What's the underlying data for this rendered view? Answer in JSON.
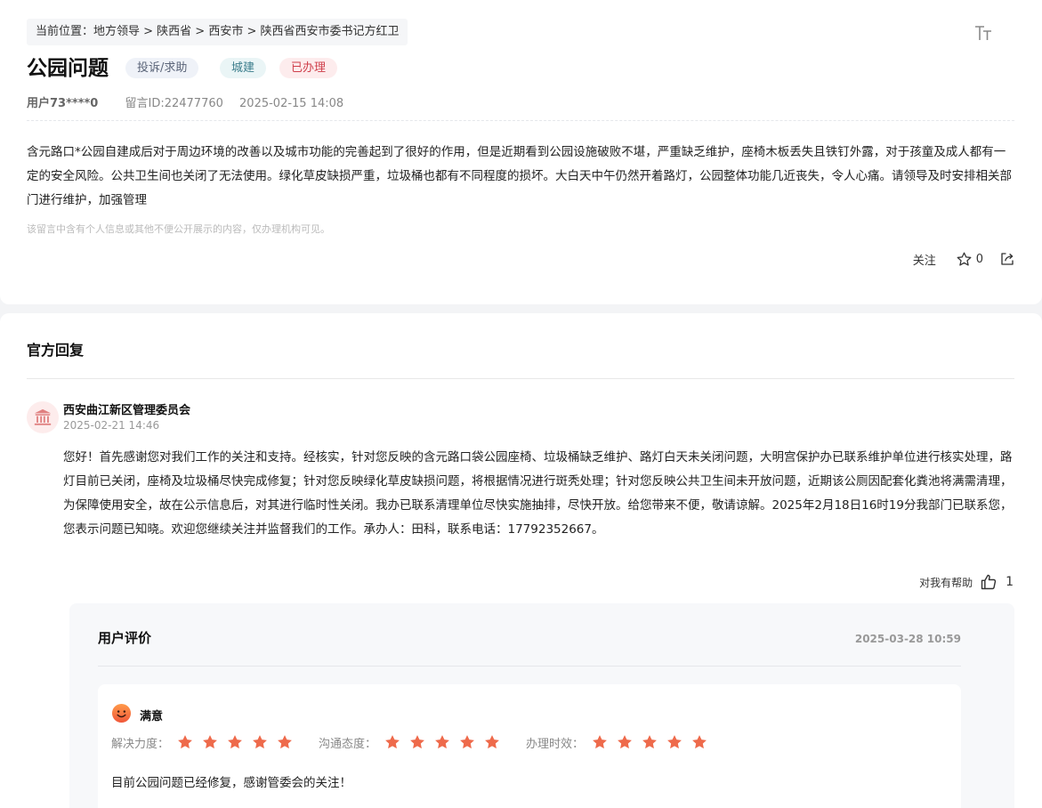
{
  "header": {
    "breadcrumb": "当前位置：地方领导 > 陕西省 > 西安市 > 陕西省西安市委书记方红卫",
    "font_size_icon": "font-size-icon"
  },
  "message": {
    "title": "公园问题",
    "tags": {
      "type": "投诉/求助",
      "category": "城建",
      "status": "已办理"
    },
    "user": "用户73****0",
    "message_id": "留言ID:22477760",
    "time": "2025-02-15 14:08",
    "content": "含元路口*公园自建成后对于周边环境的改善以及城市功能的完善起到了很好的作用，但是近期看到公园设施破败不堪，严重缺乏维护，座椅木板丢失且铁钉外露，对于孩童及成人都有一定的安全风险。公共卫生间也关闭了无法使用。绿化草皮缺损严重，垃圾桶也都有不同程度的损坏。大白天中午仍然开着路灯，公园整体功能几近丧失，令人心痛。请领导及时安排相关部门进行维护，加强管理",
    "privacy_note": "该留言中含有个人信息或其他不便公开展示的内容，仅办理机构可见。",
    "actions": {
      "follow_label": "关注",
      "star_count": "0",
      "star_icon": "star-outline-icon",
      "share_icon": "share-icon"
    }
  },
  "reply": {
    "section_title": "官方回复",
    "org_icon": "government-building-icon",
    "org_name": "西安曲江新区管理委员会",
    "time": "2025-02-21 14:46",
    "content": "您好！首先感谢您对我们工作的关注和支持。经核实，针对您反映的含元路口袋公园座椅、垃圾桶缺乏维护、路灯白天未关闭问题，大明宫保护办已联系维护单位进行核实处理，路灯目前已关闭，座椅及垃圾桶尽快完成修复；针对您反映绿化草皮缺损问题，将根据情况进行斑秃处理；针对您反映公共卫生间未开放问题，近期该公厕因配套化粪池将满需清理，为保障使用安全，故在公示信息后，对其进行临时性关闭。我办已联系清理单位尽快实施抽排，尽快开放。给您带来不便，敬请谅解。2025年2月18日16时19分我部门已联系您，您表示问题已知晓。欢迎您继续关注并监督我们的工作。承办人：田科，联系电话：17792352667。",
    "helpful_label": "对我有帮助",
    "helpful_count": "1",
    "thumb_icon": "thumbs-up-icon"
  },
  "evaluation": {
    "title": "用户评价",
    "time": "2025-03-28 10:59",
    "satisfaction_icon": "smiley-face-icon",
    "satisfaction": "满意",
    "ratings": [
      {
        "label": "解决力度：",
        "stars": 5,
        "max": 5
      },
      {
        "label": "沟通态度：",
        "stars": 5,
        "max": 5
      },
      {
        "label": "办理时效：",
        "stars": 5,
        "max": 5
      }
    ],
    "comment": "目前公园问题已经修复，感谢管委会的关注！"
  },
  "colors": {
    "star": "#ee6a4b",
    "status_tag": "#cf3f4b",
    "category_tag": "#3b7d8c",
    "avatar_icon": "#e08080"
  }
}
